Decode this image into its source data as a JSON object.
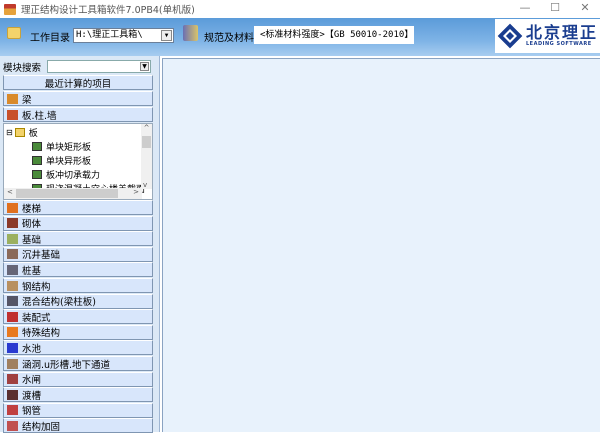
{
  "window": {
    "title": "理正结构设计工具箱软件7.0PB4(单机版)",
    "min": "—",
    "max": "☐",
    "close": "✕"
  },
  "toolbar": {
    "workdir_label": "工作目录",
    "workdir_value": "H:\\理正工具箱\\",
    "spec_label": "规范及材料",
    "spec_value": "<标准材料强度>【GB 50010-2010】"
  },
  "logo": {
    "cn": "北京理正",
    "en": "LEADING SOFTWARE"
  },
  "sidebar": {
    "search_label": "模块搜索",
    "recent": "最近计算的项目",
    "top_items": [
      {
        "label": "梁",
        "icon": "beam-icon",
        "color": "#d98a2b"
      },
      {
        "label": "板.柱.墙",
        "icon": "brick-wall-icon",
        "color": "#c8502a"
      }
    ],
    "tree": {
      "root": "板",
      "children": [
        "单块矩形板",
        "单块异形板",
        "板冲切承载力",
        "现浇混凝土空心楼盖截面"
      ]
    },
    "items": [
      {
        "label": "楼梯",
        "icon": "stairs-icon",
        "color": "#e07020"
      },
      {
        "label": "砌体",
        "icon": "masonry-icon",
        "color": "#8b3a2a"
      },
      {
        "label": "基础",
        "icon": "foundation-icon",
        "color": "#9bb060"
      },
      {
        "label": "沉井基础",
        "icon": "caisson-icon",
        "color": "#8a6a5a"
      },
      {
        "label": "桩基",
        "icon": "pile-icon",
        "color": "#667"
      },
      {
        "label": "钢结构",
        "icon": "steel-structure-icon",
        "color": "#b89060"
      },
      {
        "label": "混合结构(梁柱板)",
        "icon": "mixed-structure-icon",
        "color": "#556"
      },
      {
        "label": "装配式",
        "icon": "prefab-icon",
        "color": "#c03030"
      },
      {
        "label": "特殊结构",
        "icon": "special-structure-icon",
        "color": "#e87a20"
      },
      {
        "label": "水池",
        "icon": "pool-icon",
        "color": "#2a3ad0"
      },
      {
        "label": "涵洞.u形槽.地下通道",
        "icon": "culvert-icon",
        "color": "#a08060"
      },
      {
        "label": "水闸",
        "icon": "sluice-icon",
        "color": "#a04040"
      },
      {
        "label": "渡槽",
        "icon": "aqueduct-icon",
        "color": "#5a3030"
      },
      {
        "label": "钢管",
        "icon": "steel-pipe-icon",
        "color": "#c04040"
      },
      {
        "label": "结构加固",
        "icon": "reinforcement-icon",
        "color": "#c05050"
      }
    ]
  }
}
